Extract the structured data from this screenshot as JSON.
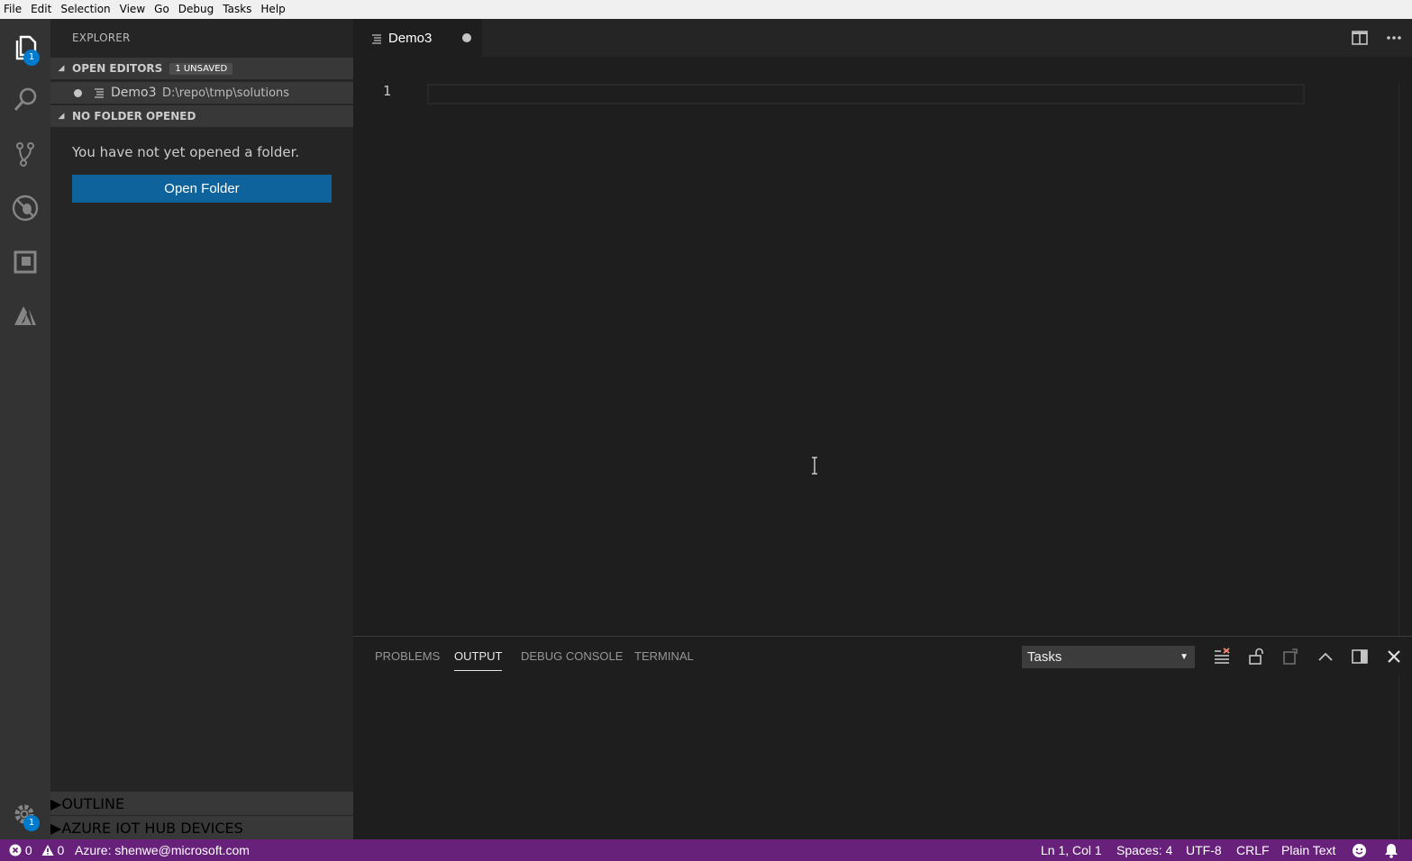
{
  "menu": [
    "File",
    "Edit",
    "Selection",
    "View",
    "Go",
    "Debug",
    "Tasks",
    "Help"
  ],
  "activity_bar": {
    "explorer_badge": "1",
    "settings_badge": "1",
    "icons": [
      "files-icon",
      "search-icon",
      "source-control-icon",
      "debug-icon",
      "extensions-icon",
      "azure-icon",
      "gear-icon"
    ]
  },
  "sidebar": {
    "title": "EXPLORER",
    "open_editors": {
      "label": "OPEN EDITORS",
      "badge": "1 UNSAVED",
      "items": [
        {
          "name": "Demo3",
          "path": "D:\\repo\\tmp\\solutions"
        }
      ]
    },
    "no_folder": {
      "label": "NO FOLDER OPENED",
      "message": "You have not yet opened a folder.",
      "button": "Open Folder"
    },
    "bottom_sections": [
      "OUTLINE",
      "AZURE IOT HUB DEVICES"
    ]
  },
  "editor": {
    "tab_label": "Demo3",
    "line_numbers": [
      "1"
    ]
  },
  "panel": {
    "tabs": [
      "PROBLEMS",
      "OUTPUT",
      "DEBUG CONSOLE",
      "TERMINAL"
    ],
    "active_tab": "OUTPUT",
    "output_channel": "Tasks"
  },
  "status_bar": {
    "errors": "0",
    "warnings": "0",
    "azure_account": "Azure: shenwe@microsoft.com",
    "position": "Ln 1, Col 1",
    "spaces": "Spaces: 4",
    "encoding": "UTF-8",
    "eol": "CRLF",
    "language": "Plain Text"
  },
  "colors": {
    "status_bar": "#68217a",
    "accent": "#0e639c",
    "badge": "#007acc"
  }
}
